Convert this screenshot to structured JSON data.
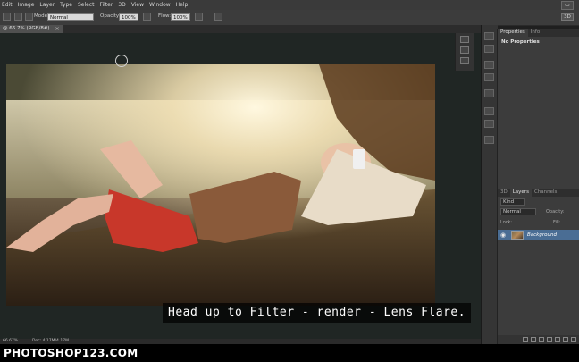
{
  "menu": [
    "Edit",
    "Image",
    "Layer",
    "Type",
    "Select",
    "Filter",
    "3D",
    "View",
    "Window",
    "Help"
  ],
  "options_bar": {
    "mode_label": "Mode:",
    "mode_value": "Normal",
    "opacity_label": "Opacity:",
    "opacity_value": "100%",
    "flow_label": "Flow:",
    "flow_value": "100%",
    "workspace": "3D"
  },
  "document_tab": {
    "title": "@ 66.7% (RGB/8#)",
    "close": "×"
  },
  "status_bar": {
    "zoom": "66.67%",
    "doc_size": "Doc: 4.17M/4.17M"
  },
  "properties_panel": {
    "tabs": [
      "Properties",
      "Info"
    ],
    "empty_text": "No Properties"
  },
  "layers_panel": {
    "tabs": [
      "3D",
      "Layers",
      "Channels"
    ],
    "kind": "Kind",
    "blend_mode": "Normal",
    "opacity_label": "Opacity:",
    "lock_label": "Lock:",
    "fill_label": "Fill:",
    "layer_name": "Background"
  },
  "caption": "Head up to Filter - render - Lens Flare.",
  "watermark": "PHOTOSHOP123.COM",
  "colors": {
    "selected_layer": "#4a6d94",
    "app_bg": "#1f1f1f"
  }
}
